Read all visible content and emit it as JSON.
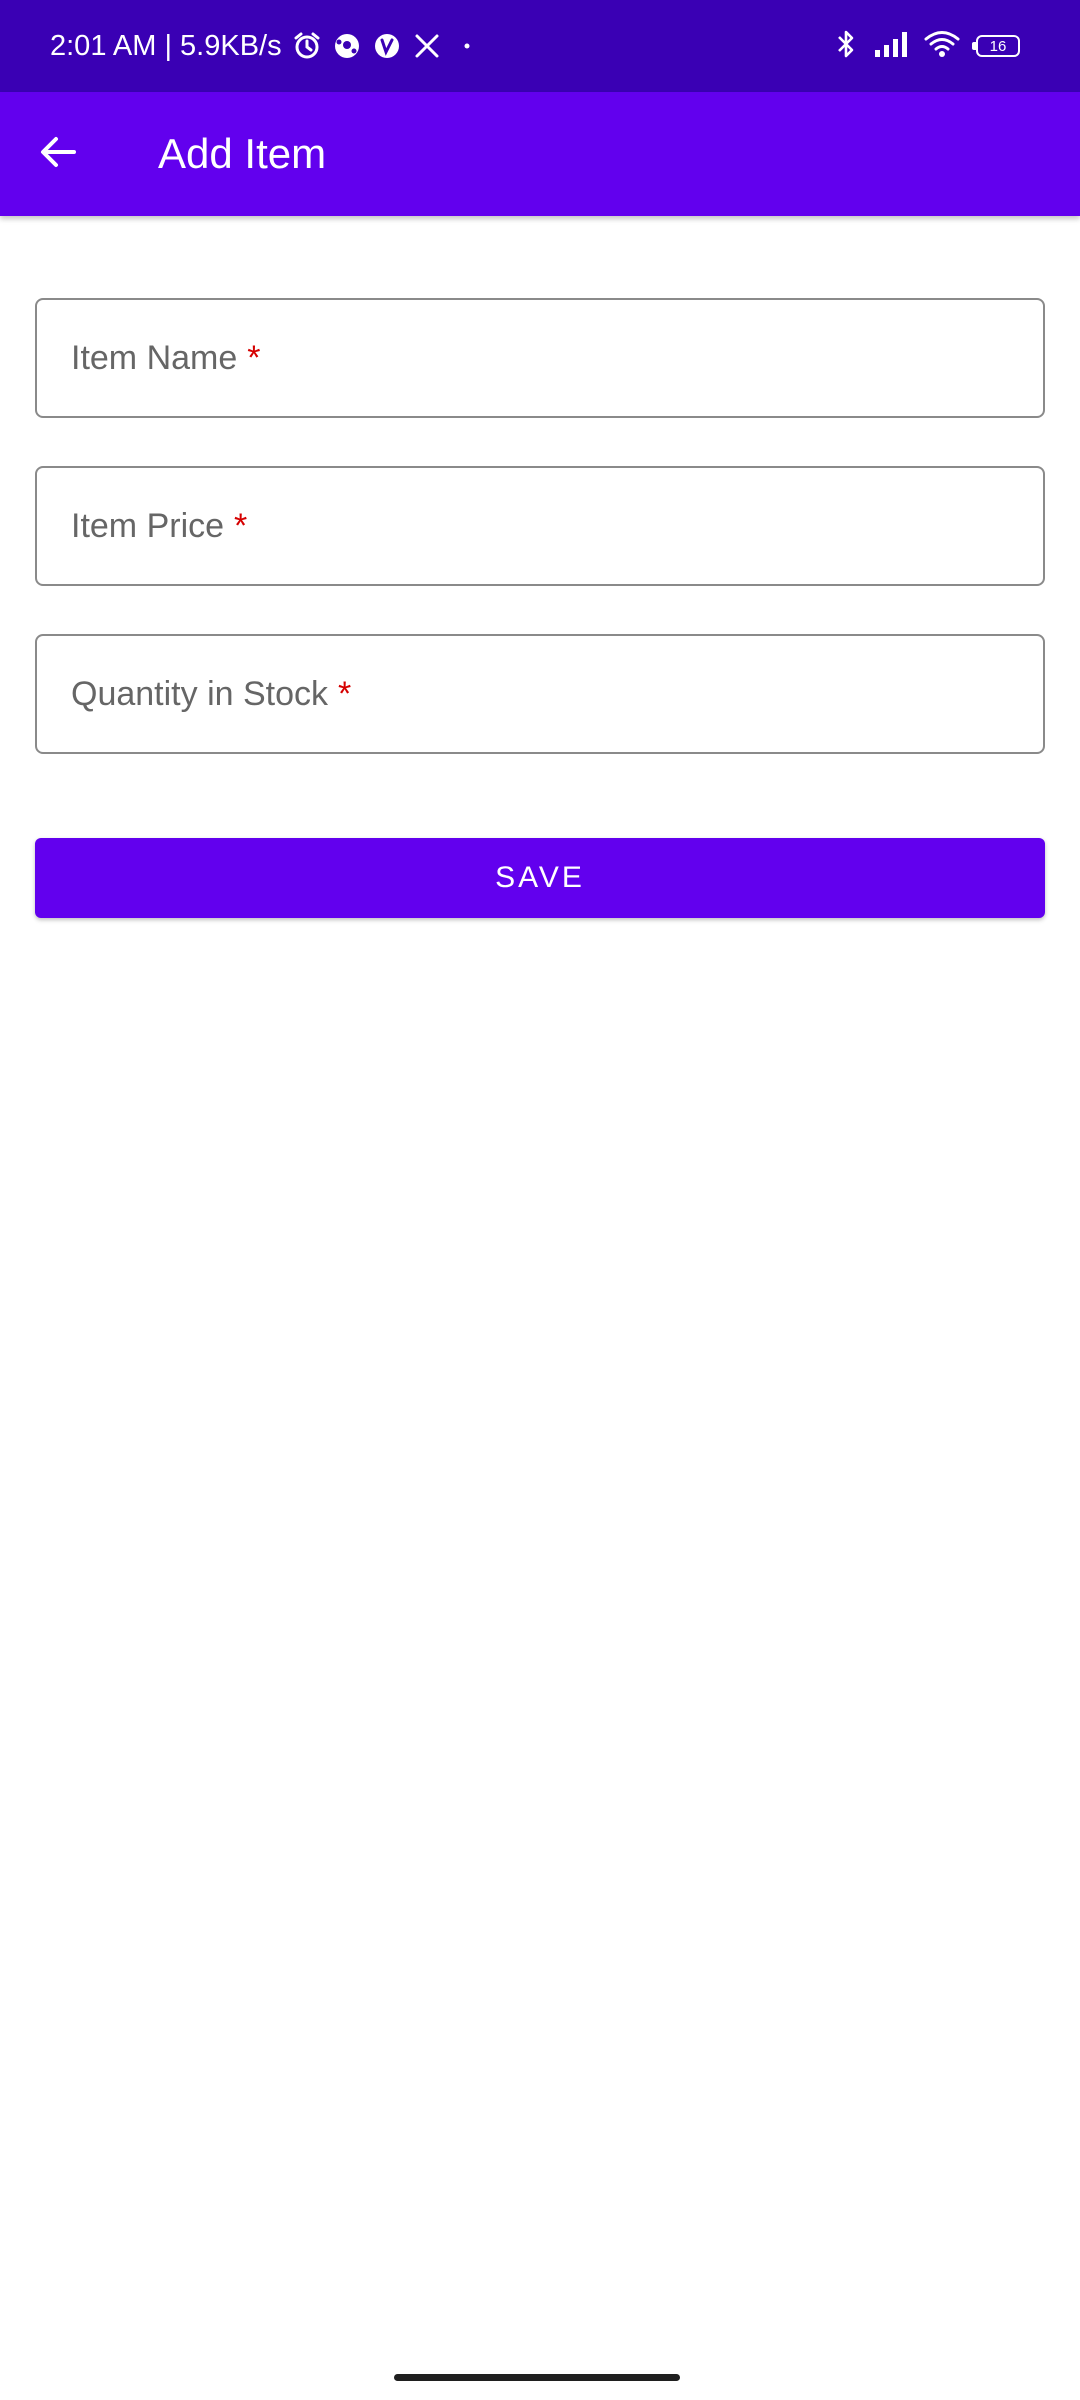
{
  "status_bar": {
    "time_network": "2:01 AM | 5.9KB/s",
    "battery_level": "16",
    "icons": [
      "alarm-icon",
      "ball-icon",
      "app-icon",
      "x-icon",
      "dot-icon",
      "bluetooth-icon",
      "signal-icon",
      "wifi-icon",
      "battery-icon"
    ],
    "background": "#3a00b4"
  },
  "app_bar": {
    "title": "Add Item",
    "background": "#6200ee"
  },
  "form": {
    "fields": [
      {
        "placeholder": "Item Name",
        "required_mark": "*"
      },
      {
        "placeholder": "Item Price",
        "required_mark": "*"
      },
      {
        "placeholder": "Quantity in Stock",
        "required_mark": "*"
      }
    ],
    "save_label": "SAVE"
  },
  "colors": {
    "accent": "#6200ee",
    "required": "#d50000"
  }
}
